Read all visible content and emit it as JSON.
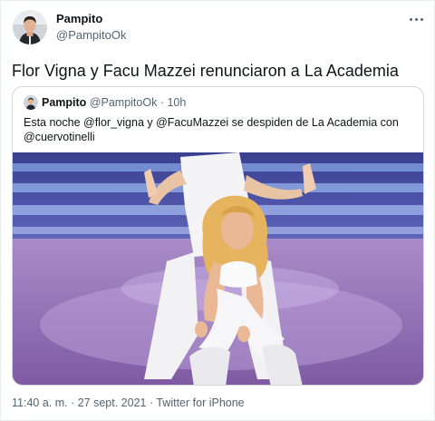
{
  "tweet": {
    "author_name": "Pampito",
    "author_handle": "@PampitoOk",
    "text": "Flor Vigna y Facu Mazzei renunciaron a La Academia",
    "footer": "11:40 a. m. · 27 sept. 2021 · Twitter for iPhone"
  },
  "quoted": {
    "author_name": "Pampito",
    "author_handle": "@PampitoOk",
    "separator": "·",
    "time": "10h",
    "text": "Esta noche @flor_vigna y @FacuMazzei se despiden de La Academia con @cuervotinelli"
  },
  "icons": {
    "more": "more-horizontal-icon"
  },
  "colors": {
    "text_primary": "#0f1419",
    "text_secondary": "#536471",
    "border": "#cfd9de"
  }
}
